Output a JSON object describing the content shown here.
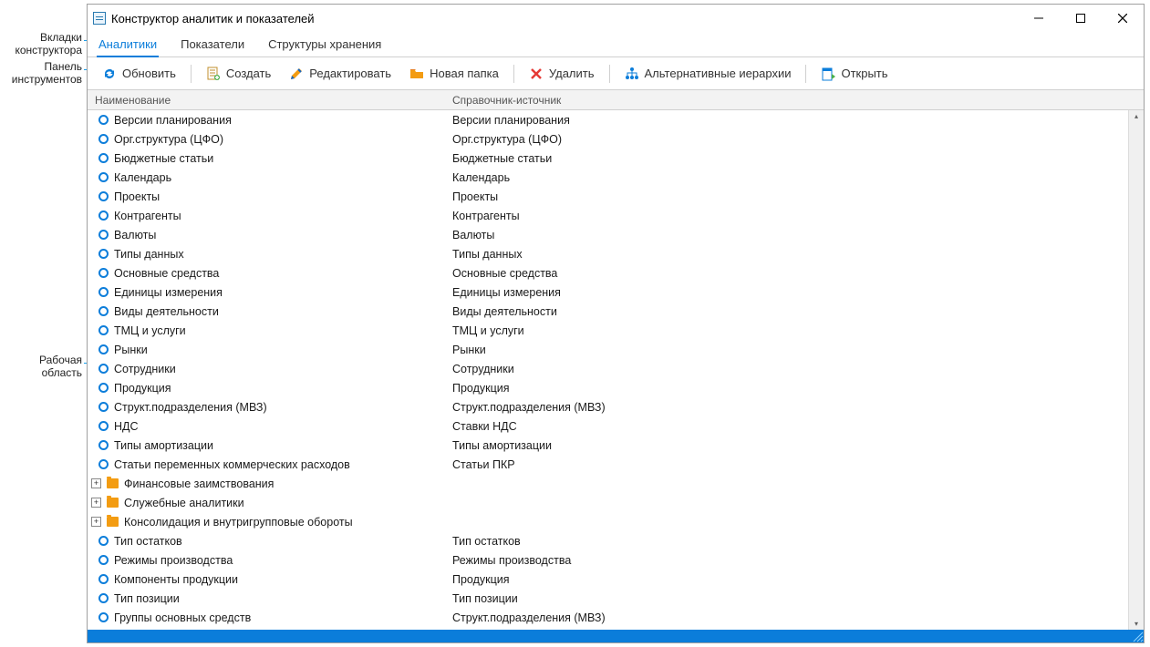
{
  "title": "Конструктор аналитик и показателей",
  "callouts": {
    "tabs": "Вкладки\nконструктора",
    "toolbar": "Панель\nинструментов",
    "workarea": "Рабочая\nобласть"
  },
  "tabs": [
    {
      "label": "Аналитики",
      "active": true
    },
    {
      "label": "Показатели",
      "active": false
    },
    {
      "label": "Структуры хранения",
      "active": false
    }
  ],
  "toolbar": [
    {
      "icon": "refresh",
      "label": "Обновить"
    },
    {
      "sep": true
    },
    {
      "icon": "new",
      "label": "Создать"
    },
    {
      "icon": "edit",
      "label": "Редактировать"
    },
    {
      "icon": "folder",
      "label": "Новая папка"
    },
    {
      "sep": true
    },
    {
      "icon": "delete",
      "label": "Удалить"
    },
    {
      "sep": true
    },
    {
      "icon": "hier",
      "label": "Альтернативные иерархии"
    },
    {
      "sep": true
    },
    {
      "icon": "open",
      "label": "Открыть"
    }
  ],
  "columns": {
    "name": "Наименование",
    "src": "Справочник-источник"
  },
  "rows": [
    {
      "type": "item",
      "name": "Версии планирования",
      "src": "Версии планирования"
    },
    {
      "type": "item",
      "name": "Орг.структура (ЦФО)",
      "src": "Орг.структура (ЦФО)"
    },
    {
      "type": "item",
      "name": "Бюджетные статьи",
      "src": "Бюджетные статьи"
    },
    {
      "type": "item",
      "name": "Календарь",
      "src": "Календарь"
    },
    {
      "type": "item",
      "name": "Проекты",
      "src": "Проекты"
    },
    {
      "type": "item",
      "name": "Контрагенты",
      "src": "Контрагенты"
    },
    {
      "type": "item",
      "name": "Валюты",
      "src": "Валюты"
    },
    {
      "type": "item",
      "name": "Типы данных",
      "src": "Типы данных"
    },
    {
      "type": "item",
      "name": "Основные средства",
      "src": "Основные средства"
    },
    {
      "type": "item",
      "name": "Единицы измерения",
      "src": "Единицы измерения"
    },
    {
      "type": "item",
      "name": "Виды деятельности",
      "src": "Виды деятельности"
    },
    {
      "type": "item",
      "name": "ТМЦ и услуги",
      "src": "ТМЦ и услуги"
    },
    {
      "type": "item",
      "name": "Рынки",
      "src": "Рынки"
    },
    {
      "type": "item",
      "name": "Сотрудники",
      "src": "Сотрудники"
    },
    {
      "type": "item",
      "name": "Продукция",
      "src": "Продукция"
    },
    {
      "type": "item",
      "name": "Структ.подразделения (МВЗ)",
      "src": "Структ.подразделения (МВЗ)"
    },
    {
      "type": "item",
      "name": "НДС",
      "src": "Ставки НДС"
    },
    {
      "type": "item",
      "name": "Типы амортизации",
      "src": "Типы амортизации"
    },
    {
      "type": "item",
      "name": "Статьи переменных коммерческих расходов",
      "src": "Статьи ПКР"
    },
    {
      "type": "folder",
      "name": "Финансовые заимствования"
    },
    {
      "type": "folder",
      "name": "Служебные аналитики"
    },
    {
      "type": "folder",
      "name": "Консолидация и внутригрупповые обороты"
    },
    {
      "type": "item",
      "name": "Тип остатков",
      "src": "Тип остатков"
    },
    {
      "type": "item",
      "name": "Режимы производства",
      "src": "Режимы производства"
    },
    {
      "type": "item",
      "name": "Компоненты продукции",
      "src": "Продукция"
    },
    {
      "type": "item",
      "name": "Тип позиции",
      "src": "Тип позиции"
    },
    {
      "type": "item",
      "name": "Группы основных средств",
      "src": "Структ.подразделения (МВЗ)"
    }
  ]
}
